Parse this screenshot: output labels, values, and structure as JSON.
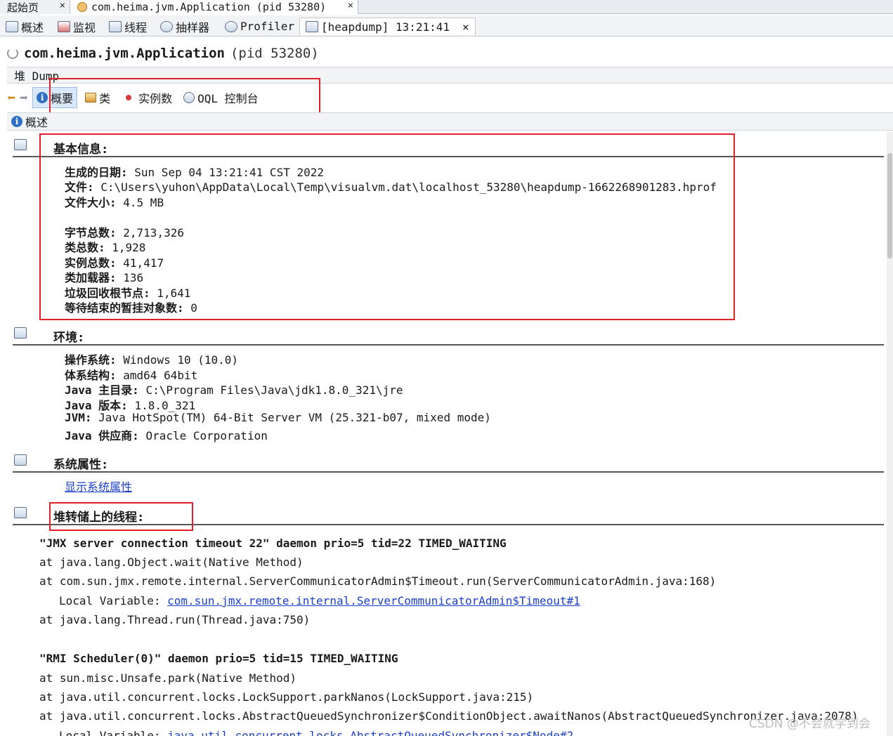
{
  "doc_tabs": [
    {
      "label": "起始页",
      "close": "×"
    },
    {
      "label": "com.heima.jvm.Application (pid 53280)",
      "close": "×"
    }
  ],
  "view_tabs": [
    {
      "label": "概述",
      "icon": "overview-icon"
    },
    {
      "label": "监视",
      "icon": "monitor-icon"
    },
    {
      "label": "线程",
      "icon": "threads-icon"
    },
    {
      "label": "抽样器",
      "icon": "sampler-icon"
    },
    {
      "label": "Profiler",
      "icon": "profiler-icon"
    },
    {
      "label": "[heapdump] 13:21:41",
      "icon": "heapdump-icon",
      "close": "×",
      "active": true
    }
  ],
  "app": {
    "name": "com.heima.jvm.Application",
    "pid": "(pid 53280)"
  },
  "subbar": {
    "label": "堆 Dump"
  },
  "toolbar": {
    "buttons": [
      {
        "label": "概要",
        "active": true
      },
      {
        "label": "类"
      },
      {
        "label": "实例数"
      },
      {
        "label": "OQL 控制台"
      }
    ]
  },
  "section_bar": {
    "label": "概述"
  },
  "basic_info": {
    "title": "基本信息:",
    "rows": [
      {
        "k": "生成的日期:",
        "v": " Sun Sep 04 13:21:41 CST 2022"
      },
      {
        "k": "文件:",
        "v": " C:\\Users\\yuhon\\AppData\\Local\\Temp\\visualvm.dat\\localhost_53280\\heapdump-1662268901283.hprof"
      },
      {
        "k": "文件大小:",
        "v": " 4.5 MB"
      },
      {
        "k": "字节总数:",
        "v": " 2,713,326"
      },
      {
        "k": "类总数:",
        "v": " 1,928"
      },
      {
        "k": "实例总数:",
        "v": " 41,417"
      },
      {
        "k": "类加载器:",
        "v": " 136"
      },
      {
        "k": "垃圾回收根节点:",
        "v": " 1,641"
      },
      {
        "k": "等待结束的暂挂对象数:",
        "v": " 0"
      }
    ]
  },
  "environment": {
    "title": "环境:",
    "rows": [
      {
        "k": "操作系统:",
        "v": " Windows 10 (10.0)"
      },
      {
        "k": "体系结构:",
        "v": " amd64 64bit"
      },
      {
        "k": "Java 主目录:",
        "v": " C:\\Program Files\\Java\\jdk1.8.0_321\\jre"
      },
      {
        "k": "Java 版本:",
        "v": " 1.8.0_321"
      },
      {
        "k": "JVM:",
        "v": " Java HotSpot(TM) 64-Bit Server VM (25.321-b07, mixed mode)"
      },
      {
        "k": "Java 供应商:",
        "v": " Oracle Corporation"
      }
    ]
  },
  "system_props": {
    "title": "系统属性:",
    "link": "显示系统属性"
  },
  "threads": {
    "title": "堆转储上的线程:",
    "items": [
      {
        "title": "\"JMX server connection timeout 22\" daemon prio=5 tid=22 TIMED_WAITING",
        "frames": [
          "at java.lang.Object.wait(Native Method)",
          "at com.sun.jmx.remote.internal.ServerCommunicatorAdmin$Timeout.run(ServerCommunicatorAdmin.java:168)"
        ],
        "local_label": "Local Variable: ",
        "local_link": "com.sun.jmx.remote.internal.ServerCommunicatorAdmin$Timeout#1",
        "frames_after": [
          "at java.lang.Thread.run(Thread.java:750)"
        ]
      },
      {
        "title": "\"RMI Scheduler(0)\" daemon prio=5 tid=15 TIMED_WAITING",
        "frames": [
          "at sun.misc.Unsafe.park(Native Method)",
          "at java.util.concurrent.locks.LockSupport.parkNanos(LockSupport.java:215)",
          "at java.util.concurrent.locks.AbstractQueuedSynchronizer$ConditionObject.awaitNanos(AbstractQueuedSynchronizer.java:2078)"
        ],
        "local_label": "Local Variable: ",
        "local_link": "java.util.concurrent.locks.AbstractQueuedSynchronizer$Node#2"
      }
    ]
  },
  "watermark": "CSDN @不会就学到会",
  "colors": {
    "highlight_box": "#e0202a",
    "link": "#1a3fcc",
    "active_tab_bg": "#d9e8fb"
  }
}
